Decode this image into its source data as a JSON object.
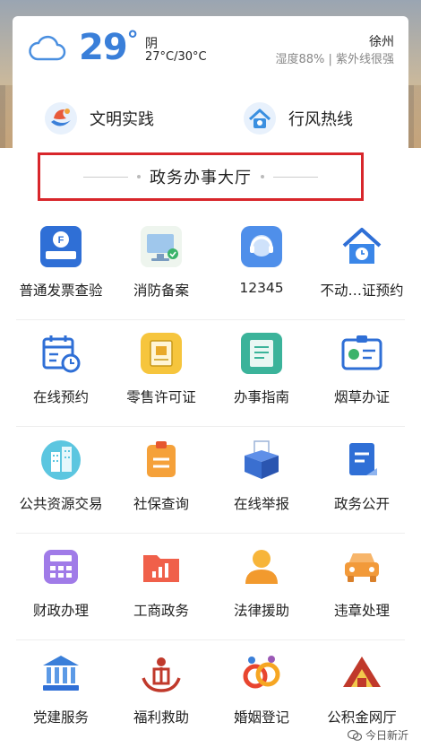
{
  "weather": {
    "temp": "29",
    "deg": "°",
    "condition": "阴",
    "range": "27°C/30°C",
    "city": "徐州",
    "humidity": "湿度88% | 紫外线很强"
  },
  "quick": [
    {
      "label": "文明实践",
      "icon": "civilization-practice-icon"
    },
    {
      "label": "行风热线",
      "icon": "hotline-house-icon"
    }
  ],
  "section_title": "政务办事大厅",
  "services": [
    [
      "普通发票查验",
      "消防备案",
      "12345",
      "不动…证预约"
    ],
    [
      "在线预约",
      "零售许可证",
      "办事指南",
      "烟草办证"
    ],
    [
      "公共资源交易",
      "社保查询",
      "在线举报",
      "政务公开"
    ],
    [
      "财政办理",
      "工商政务",
      "法律援助",
      "违章处理"
    ],
    [
      "党建服务",
      "福利救助",
      "婚姻登记",
      "公积金网厅"
    ]
  ],
  "watermark": "今日新沂",
  "colors": {
    "accent_blue": "#3a7fd9",
    "highlight_red": "#d8262b"
  }
}
